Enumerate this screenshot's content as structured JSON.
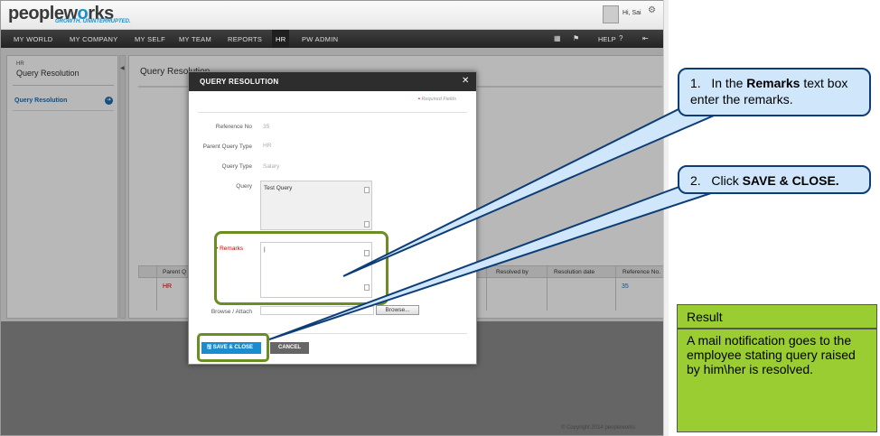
{
  "app": {
    "logo_left": "peoplew",
    "logo_mid": "o",
    "logo_right": "rks",
    "tagline": "GROWTH. UNINTERRUPTED.",
    "user_greeting": "Hi, Sai",
    "copyright": "© Copyright 2014  peopleworks"
  },
  "nav": {
    "items": [
      "MY WORLD",
      "MY COMPANY",
      "MY SELF",
      "MY TEAM",
      "REPORTS",
      "HR",
      "PW ADMIN"
    ],
    "active": "HR",
    "help": "HELP"
  },
  "sidebar": {
    "section": "HR",
    "title": "Query Resolution",
    "link": "Query Resolution"
  },
  "main": {
    "title": "Query Resolution",
    "grid": {
      "headers": [
        "Parent Q",
        "Resolved by",
        "Resolution date",
        "Reference No."
      ],
      "row": {
        "parent": "HR",
        "reference": "35"
      }
    }
  },
  "modal": {
    "title": "QUERY RESOLUTION",
    "required_note": "Required Fields",
    "fields": {
      "reference_label": "Reference No",
      "reference_value": "35",
      "parent_label": "Parent Query Type",
      "parent_value": "HR",
      "type_label": "Query Type",
      "type_value": "Salary",
      "query_label": "Query",
      "query_value": "Test Query",
      "remarks_label": "Remarks",
      "browse_label": "Browse / Attach",
      "browse_button": "Browse..."
    },
    "save_button": "SAVE & CLOSE",
    "cancel_button": "CANCEL"
  },
  "callouts": {
    "step1_num": "1.",
    "step1_pre": "In the ",
    "step1_bold": "Remarks",
    "step1_post": " text box enter the remarks.",
    "step2_num": "2.",
    "step2_pre": "Click ",
    "step2_bold": "SAVE & CLOSE."
  },
  "result": {
    "heading": "Result",
    "text": "A mail notification goes to the employee stating  query raised by  him\\her is resolved."
  },
  "colors": {
    "highlight": "#6b8e23",
    "callout_fill": "#cfe6fb",
    "callout_border": "#0d3d76",
    "result_fill": "#9acd32",
    "primary_button": "#1a8cd0"
  }
}
